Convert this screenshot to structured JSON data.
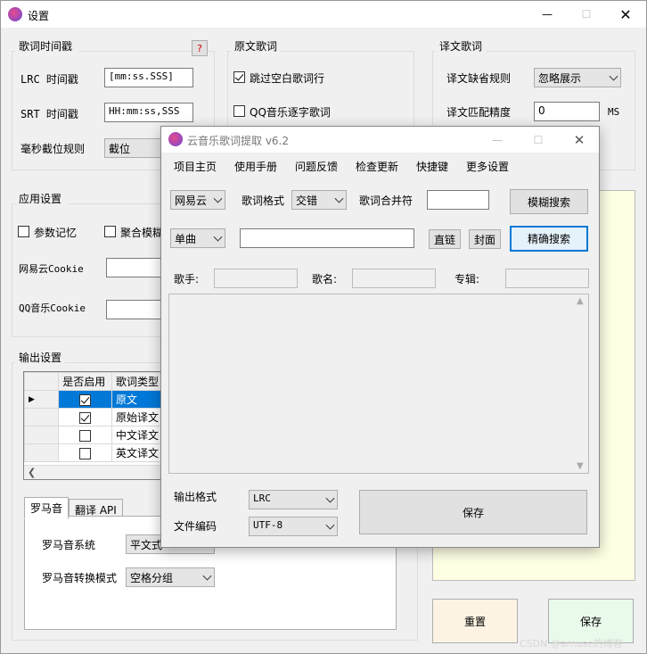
{
  "settings_window": {
    "title": "设置",
    "groups": {
      "lyric_timestamp": "歌词时间戳",
      "original_lyric": "原文歌词",
      "translation_lyric": "译文歌词",
      "app_settings": "应用设置",
      "output_settings": "输出设置"
    },
    "help_label": "?",
    "lrc_label": "LRC 时间戳",
    "lrc_value": "[mm:ss.SSS]",
    "srt_label": "SRT 时间戳",
    "srt_value": "HH:mm:ss,SSS",
    "ms_rule_label": "毫秒截位规则",
    "ms_rule_value": "截位",
    "skip_blank_label": "跳过空白歌词行",
    "qq_word_label": "QQ音乐逐字歌词",
    "trans_missing_label": "译文缺省规则",
    "trans_missing_value": "忽略展示",
    "trans_match_label": "译文匹配精度",
    "trans_match_value": "0",
    "trans_match_unit": "MS",
    "param_memory_label": "参数记忆",
    "aggregate_label": "聚合模糊",
    "netease_cookie_label": "网易云Cookie",
    "qq_cookie_label": "QQ音乐Cookie",
    "grid": {
      "headers": [
        "",
        "是否启用",
        "歌词类型"
      ],
      "rows": [
        {
          "enabled": true,
          "type": "原文"
        },
        {
          "enabled": true,
          "type": "原始译文"
        },
        {
          "enabled": false,
          "type": "中文译文"
        },
        {
          "enabled": false,
          "type": "英文译文"
        }
      ]
    },
    "tabs": [
      "罗马音",
      "翻译 API"
    ],
    "romaji_system_label": "罗马音系统",
    "romaji_system_value": "平文式",
    "romaji_mode_label": "罗马音转换模式",
    "romaji_mode_value": "空格分组",
    "reset_label": "重置",
    "save_label": "保存",
    "watermark": "CSDN @amuse的博客"
  },
  "main_window": {
    "title": "云音乐歌词提取 v6.2",
    "menu": [
      "项目主页",
      "使用手册",
      "问题反馈",
      "检查更新",
      "快捷键",
      "更多设置"
    ],
    "source_value": "网易云",
    "lyric_format_label": "歌词格式",
    "lyric_format_value": "交错",
    "merge_label": "歌词合并符",
    "merge_value": "",
    "fuzzy_search_label": "模糊搜索",
    "mode_value": "单曲",
    "search_input_value": "",
    "link_label": "直链",
    "cover_label": "封面",
    "exact_search_label": "精确搜索",
    "singer_label": "歌手:",
    "song_label": "歌名:",
    "album_label": "专辑:",
    "output_format_label": "输出格式",
    "output_format_value": "LRC",
    "encoding_label": "文件编码",
    "encoding_value": "UTF-8",
    "save_label": "保存"
  },
  "colors": {
    "accent": "#0078d7",
    "reset_bg": "#fcf3e3",
    "save_bg": "#e9f9ea",
    "preview_bg": "#ffffe4"
  }
}
